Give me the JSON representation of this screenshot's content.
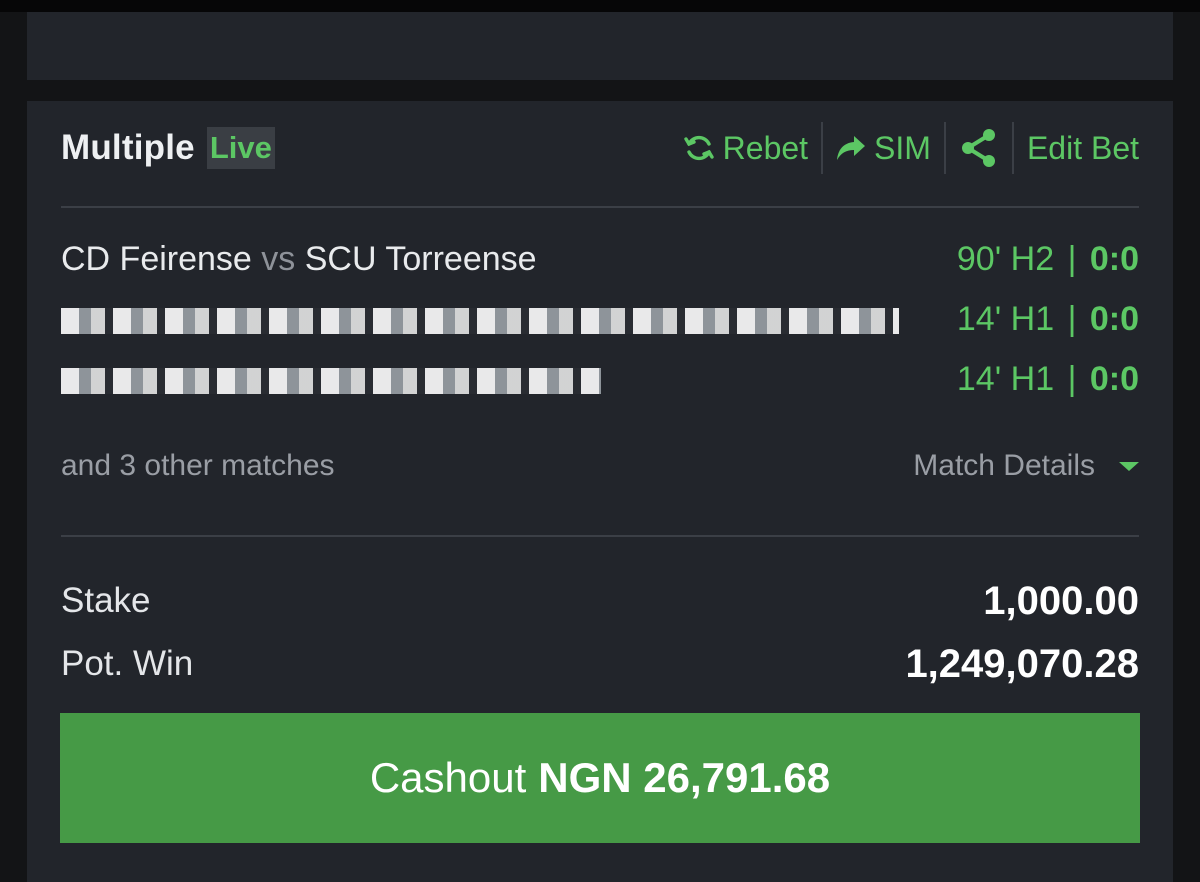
{
  "bet": {
    "type_label": "Multiple",
    "live_label": "Live",
    "actions": {
      "rebet": "Rebet",
      "sim": "SIM",
      "edit": "Edit Bet"
    },
    "matches": [
      {
        "home": "CD Feirense",
        "vs": "vs",
        "away": "SCU Torreense",
        "time": "90' H2",
        "sep": "|",
        "score": "0:0",
        "redacted": false
      },
      {
        "home": "",
        "vs": "",
        "away": "",
        "time": "14' H1",
        "sep": "|",
        "score": "0:0",
        "redacted": true
      },
      {
        "home": "",
        "vs": "",
        "away": "",
        "time": "14' H1",
        "sep": "|",
        "score": "0:0",
        "redacted": true
      }
    ],
    "other_matches": "and 3 other matches",
    "match_details": "Match Details",
    "stake_label": "Stake",
    "stake_value": "1,000.00",
    "pot_win_label": "Pot. Win",
    "pot_win_value": "1,249,070.28",
    "cashout_label": "Cashout",
    "cashout_amount": "NGN 26,791.68"
  },
  "colors": {
    "accent": "#5cc764",
    "card_bg": "#22252b",
    "cashout_bg": "#469a46"
  },
  "icons": [
    "refresh-icon",
    "share-arrow-icon",
    "share-nodes-icon",
    "caret-down-icon"
  ]
}
